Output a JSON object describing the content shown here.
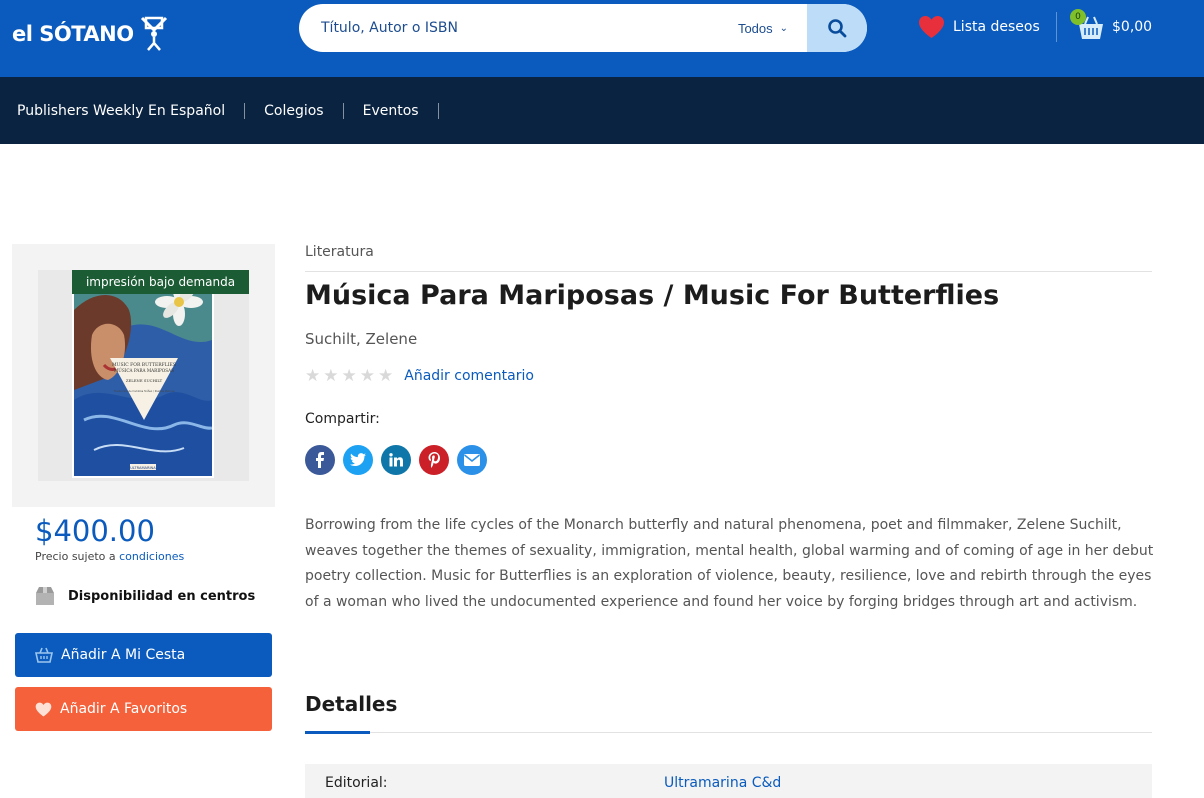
{
  "header": {
    "logo_text": "el SÓTANO",
    "search": {
      "placeholder": "Título, Autor o ISBN",
      "category": "Todos"
    },
    "wishlist_label": "Lista deseos",
    "cart": {
      "count": "0",
      "total": "$0,00"
    }
  },
  "nav": {
    "items": [
      {
        "label": "Publishers Weekly En Español"
      },
      {
        "label": "Colegios"
      },
      {
        "label": "Eventos"
      }
    ]
  },
  "product": {
    "badge": "impresión bajo demanda",
    "category": "Literatura",
    "title": "Música Para Mariposas / Music For Butterflies",
    "author": "Suchilt, Zelene",
    "rating": 0,
    "add_comment": "Añadir comentario",
    "share_label": "Compartir:",
    "share": [
      {
        "icon": "facebook-icon",
        "color": "#3b5998"
      },
      {
        "icon": "twitter-icon",
        "color": "#1da1f2"
      },
      {
        "icon": "linkedin-icon",
        "color": "#0e76a8"
      },
      {
        "icon": "pinterest-icon",
        "color": "#cb2027"
      },
      {
        "icon": "email-icon",
        "color": "#2b90e8"
      }
    ],
    "description": "Borrowing from the life cycles of the Monarch butterfly and natural phenomena, poet and filmmaker, Zelene Suchilt, weaves together the themes of sexuality, immigration, mental health, global warming and of coming of age in her debut poetry collection. Music for Butterflies is an exploration of violence, beauty, resilience, love and rebirth through the eyes of a woman who lived the undocumented experience and found her voice by forging bridges through art and activism.",
    "price": "$400.00",
    "price_note_prefix": "Precio sujeto a ",
    "price_note_link": "condiciones",
    "availability": "Disponibilidad en centros",
    "add_to_cart": "Añadir A Mi Cesta",
    "add_to_favorites": "Añadir A Favoritos"
  },
  "cover": {
    "line1": "MUSIC FOR BUTTERFLIES",
    "line2": "MÚSICA PARA MARIPOSAS",
    "author": "ZELENE SUCHILT",
    "translators": "Traducción de Carolina Núñez / Paulina Pavlova",
    "publisher": "ULTRAMARINA"
  },
  "details": {
    "heading": "Detalles",
    "rows": [
      {
        "label": "Editorial:",
        "value": "Ultramarina C&d"
      }
    ]
  },
  "colors": {
    "brand_blue": "#0a5bbd",
    "nav_dark": "#0a2340",
    "favorite_orange": "#f4613a",
    "badge_green": "#1c5c34"
  }
}
